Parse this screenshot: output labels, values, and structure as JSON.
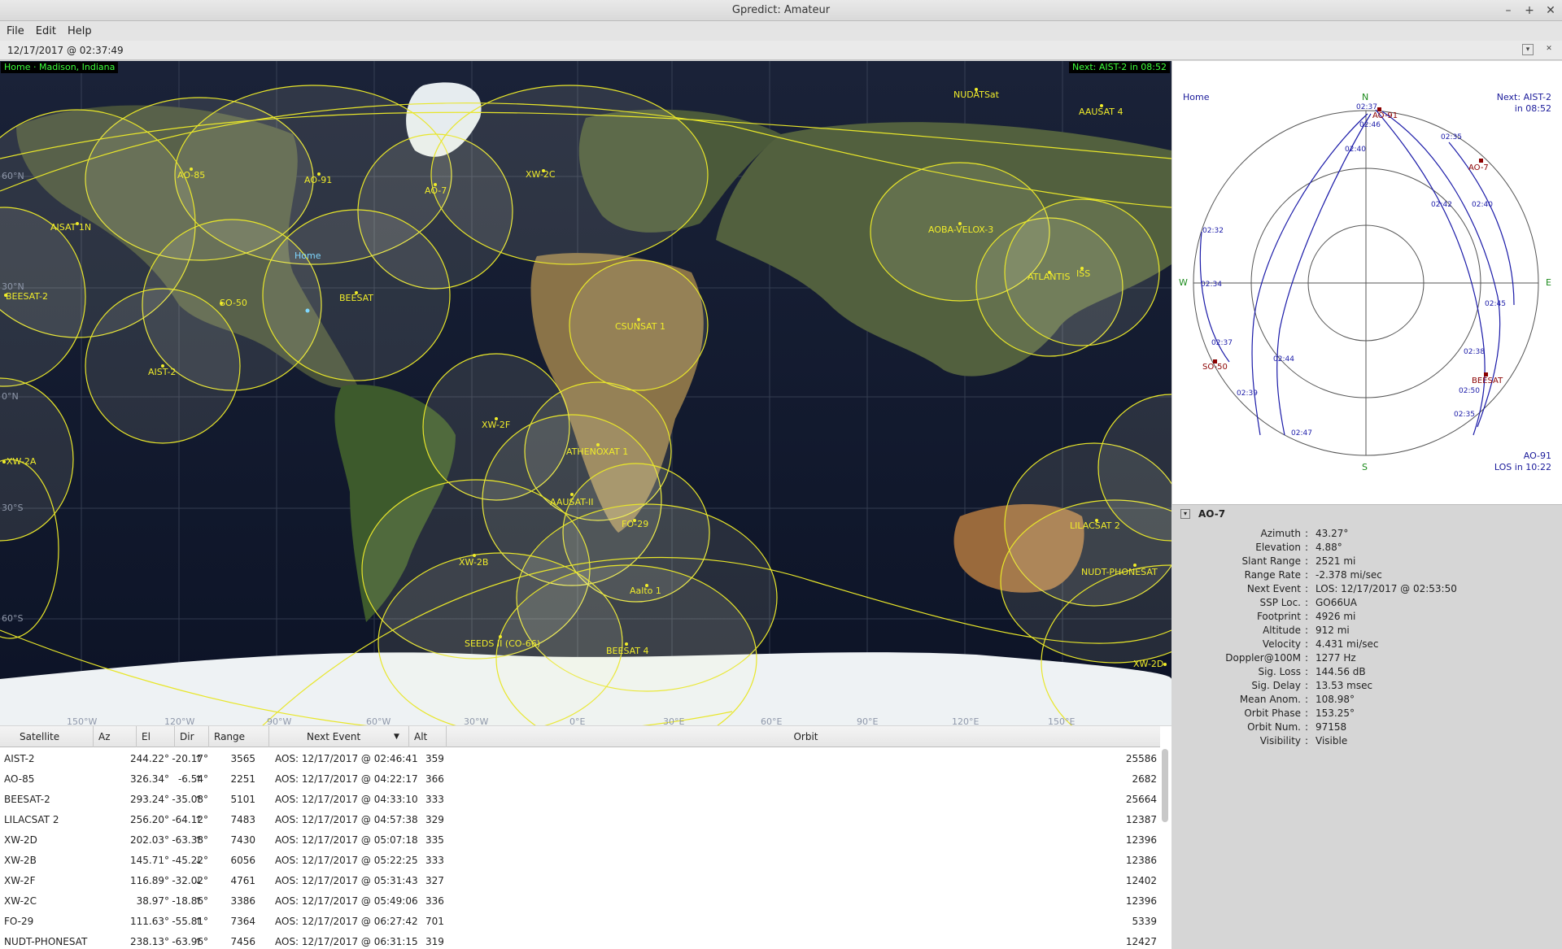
{
  "window": {
    "title": "Gpredict: Amateur",
    "minimize": "–",
    "maximize": "+",
    "close": "✕"
  },
  "menu": {
    "file": "File",
    "edit": "Edit",
    "help": "Help"
  },
  "clock": {
    "datetime": "12/17/2017 @ 02:37:49",
    "toggle_icon": "▾",
    "close_icon": "✕"
  },
  "map": {
    "home_label": "Home · Madison, Indiana",
    "next_label": "Next: AIST-2 in 08:52",
    "home_marker": "Home",
    "lat_labels": [
      "60°N",
      "30°N",
      "0°N",
      "30°S",
      "60°S"
    ],
    "lon_labels": [
      "150°W",
      "120°W",
      "90°W",
      "60°W",
      "30°W",
      "0°E",
      "30°E",
      "60°E",
      "90°E",
      "120°E",
      "150°E"
    ],
    "satellites": [
      "NUDATSat",
      "AAUSAT 4",
      "AO-85",
      "AO-91",
      "AO-7",
      "XW-2C",
      "AISAT 1N",
      "BEESAT-2",
      "SO-50",
      "BEESAT",
      "AOBA-VELOX-3",
      "ATLANTIS",
      "ISS",
      "CSUNSAT 1",
      "AIST-2",
      "XW-2A",
      "XW-2F",
      "ATHENOXAT 1",
      "AAUSAT-II",
      "FO-29",
      "XW-2B",
      "Aalto 1",
      "SEEDS II (CO-66)",
      "BEESAT 4",
      "LILACSAT 2",
      "NUDT-PHONESAT",
      "XW-2D"
    ],
    "colors": {
      "footprint": "#e8e62a",
      "label": "#f0ec2a",
      "home": "#7fd7ff"
    }
  },
  "polar": {
    "home": "Home",
    "next_line1": "Next: AIST-2",
    "next_line2": "in 08:52",
    "n": "N",
    "s": "S",
    "e": "E",
    "w": "W",
    "los_line1": "AO-91",
    "los_line2": "LOS in 10:22",
    "sats": [
      "AO-91",
      "AO-7",
      "SO-50",
      "BEESAT"
    ],
    "times": [
      "02:37",
      "02:46",
      "02:40",
      "02:35",
      "02:42",
      "02:40",
      "02:32",
      "02:34",
      "02:37",
      "02:44",
      "02:39",
      "02:47",
      "02:45",
      "02:38",
      "02:50",
      "02:35"
    ]
  },
  "info": {
    "title": "AO-7",
    "toggle_icon": "▾",
    "rows": [
      {
        "label": "Azimuth",
        "value": "43.27°"
      },
      {
        "label": "Elevation",
        "value": "4.88°"
      },
      {
        "label": "Slant Range",
        "value": "2521 mi"
      },
      {
        "label": "Range Rate",
        "value": "-2.378 mi/sec"
      },
      {
        "label": "Next Event",
        "value": "LOS: 12/17/2017 @ 02:53:50"
      },
      {
        "label": "SSP Loc.",
        "value": "GO66UA"
      },
      {
        "label": "Footprint",
        "value": "4926 mi"
      },
      {
        "label": "Altitude",
        "value": "912 mi"
      },
      {
        "label": "Velocity",
        "value": "4.431 mi/sec"
      },
      {
        "label": "Doppler@100M",
        "value": "1277 Hz"
      },
      {
        "label": "Sig. Loss",
        "value": "144.56 dB"
      },
      {
        "label": "Sig. Delay",
        "value": "13.53 msec"
      },
      {
        "label": "Mean Anom.",
        "value": "108.98°"
      },
      {
        "label": "Orbit Phase",
        "value": "153.25°"
      },
      {
        "label": "Orbit Num.",
        "value": "97158"
      },
      {
        "label": "Visibility",
        "value": "Visible"
      }
    ]
  },
  "table": {
    "headers": {
      "satellite": "Satellite",
      "az": "Az",
      "el": "El",
      "dir": "Dir",
      "range": "Range",
      "next_event": "Next Event",
      "alt": "Alt",
      "orbit": "Orbit"
    },
    "sort_icon": "▼",
    "rows": [
      {
        "sat": "AIST-2",
        "az": "244.22°",
        "el": "-20.17°",
        "dir": "↑",
        "range": "3565",
        "next": "AOS: 12/17/2017 @ 02:46:41",
        "alt": "359",
        "orbit": "25586"
      },
      {
        "sat": "AO-85",
        "az": "326.34°",
        "el": "-6.54°",
        "dir": "↑",
        "range": "2251",
        "next": "AOS: 12/17/2017 @ 04:22:17",
        "alt": "366",
        "orbit": "2682"
      },
      {
        "sat": "BEESAT-2",
        "az": "293.24°",
        "el": "-35.08°",
        "dir": "↑",
        "range": "5101",
        "next": "AOS: 12/17/2017 @ 04:33:10",
        "alt": "333",
        "orbit": "25664"
      },
      {
        "sat": "LILACSAT 2",
        "az": "256.20°",
        "el": "-64.12°",
        "dir": "↑",
        "range": "7483",
        "next": "AOS: 12/17/2017 @ 04:57:38",
        "alt": "329",
        "orbit": "12387"
      },
      {
        "sat": "XW-2D",
        "az": "202.03°",
        "el": "-63.38°",
        "dir": "↑",
        "range": "7430",
        "next": "AOS: 12/17/2017 @ 05:07:18",
        "alt": "335",
        "orbit": "12396"
      },
      {
        "sat": "XW-2B",
        "az": "145.71°",
        "el": "-45.22°",
        "dir": "↓",
        "range": "6056",
        "next": "AOS: 12/17/2017 @ 05:22:25",
        "alt": "333",
        "orbit": "12386"
      },
      {
        "sat": "XW-2F",
        "az": "116.89°",
        "el": "-32.02°",
        "dir": "↓",
        "range": "4761",
        "next": "AOS: 12/17/2017 @ 05:31:43",
        "alt": "327",
        "orbit": "12402"
      },
      {
        "sat": "XW-2C",
        "az": "38.97°",
        "el": "-18.86°",
        "dir": "↑",
        "range": "3386",
        "next": "AOS: 12/17/2017 @ 05:49:06",
        "alt": "336",
        "orbit": "12396"
      },
      {
        "sat": "FO-29",
        "az": "111.63°",
        "el": "-55.81°",
        "dir": "↑",
        "range": "7364",
        "next": "AOS: 12/17/2017 @ 06:27:42",
        "alt": "701",
        "orbit": "5339"
      },
      {
        "sat": "NUDT-PHONESAT",
        "az": "238.13°",
        "el": "-63.96°",
        "dir": "↑",
        "range": "7456",
        "next": "AOS: 12/17/2017 @ 06:31:15",
        "alt": "319",
        "orbit": "12427"
      }
    ]
  }
}
